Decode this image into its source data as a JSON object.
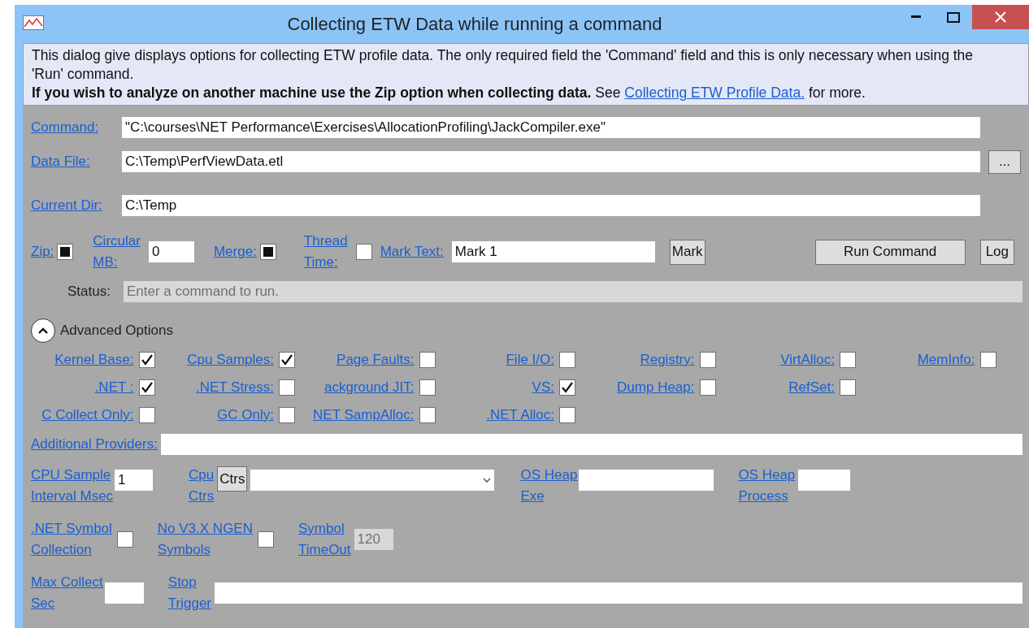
{
  "window": {
    "title": "Collecting ETW Data while running a command"
  },
  "info": {
    "text": "This dialog give displays options for collecting ETW profile data. The only required field the 'Command' field and this is only necessary when using the 'Run' command.",
    "note": "**If you wish to analyze on another machine use the Zip option when collecting data.** See ",
    "link": "Collecting ETW Profile Data.",
    "note_end": " for more."
  },
  "paths": [
    {
      "label": "Command:",
      "value": "\"C:\\courses\\NET Performance\\Exercises\\AllocationProfiling\\JackCompiler.exe\""
    },
    {
      "label": "Data File:",
      "value": "C:\\Temp\\PerfViewData.etl",
      "browse": "..."
    },
    {
      "label": "Current Dir:",
      "value": "C:\\Temp"
    }
  ],
  "options": {
    "zip": {
      "label": "Zip:",
      "checked": true
    },
    "circular": {
      "label": "Circular\nMB:",
      "value": "0"
    },
    "merge": {
      "label": "Merge:",
      "checked": true
    },
    "thread_time": {
      "label": "Thread\nTime:",
      "checked": false
    },
    "mark_text": {
      "label": "Mark Text:",
      "value": "Mark 1"
    },
    "mark_button": "Mark",
    "run_button": "Run Command",
    "log_button": "Log"
  },
  "status": {
    "label": "Status:",
    "value": "Enter a command to run."
  },
  "advanced": {
    "label": "Advanced Options",
    "expanded": true,
    "rows": [
      [
        {
          "label": "Kernel Base:",
          "checked": true
        },
        {
          "label": "Cpu Samples:",
          "checked": true
        },
        {
          "label": "Page Faults:",
          "checked": false
        },
        {
          "label": "File I/O:",
          "checked": false
        },
        {
          "label": "Registry:",
          "checked": false
        },
        {
          "label": "VirtAlloc:",
          "checked": false
        },
        {
          "label": "MemInfo:",
          "checked": false
        }
      ],
      [
        {
          "label": ".NET :",
          "checked": true
        },
        {
          "label": ".NET Stress:",
          "checked": false
        },
        {
          "label": "ackground JIT:",
          "checked": false
        },
        {
          "label": "VS:",
          "checked": true
        },
        {
          "label": "Dump Heap:",
          "checked": false
        },
        {
          "label": "RefSet:",
          "checked": false
        }
      ],
      [
        {
          "label": "C Collect Only:",
          "checked": false
        },
        {
          "label": "GC Only:",
          "checked": false
        },
        {
          "label": "NET SampAlloc:",
          "checked": false
        },
        {
          "label": ".NET Alloc:",
          "checked": false
        }
      ]
    ]
  },
  "additional_providers": {
    "label": "Additional Providers:"
  },
  "cpu_sample": {
    "label": "CPU Sample\nInterval Msec",
    "value": "1"
  },
  "cpu_ctrs": {
    "label": "Cpu\nCtrs",
    "button": "Ctrs"
  },
  "os_heap_exe": {
    "label": "OS Heap\nExe"
  },
  "os_heap_process": {
    "label": "OS Heap\nProcess"
  },
  "net_symbol": {
    "label": ".NET Symbol\nCollection",
    "checked": false
  },
  "no_ngen": {
    "label": "No V3.X NGEN\nSymbols",
    "checked": false
  },
  "symbol_timeout": {
    "label": "Symbol\nTimeOut",
    "value": "120",
    "disabled": true
  },
  "max_collect": {
    "label": "Max Collect\nSec"
  },
  "stop_trigger": {
    "label": "Stop\nTrigger"
  }
}
